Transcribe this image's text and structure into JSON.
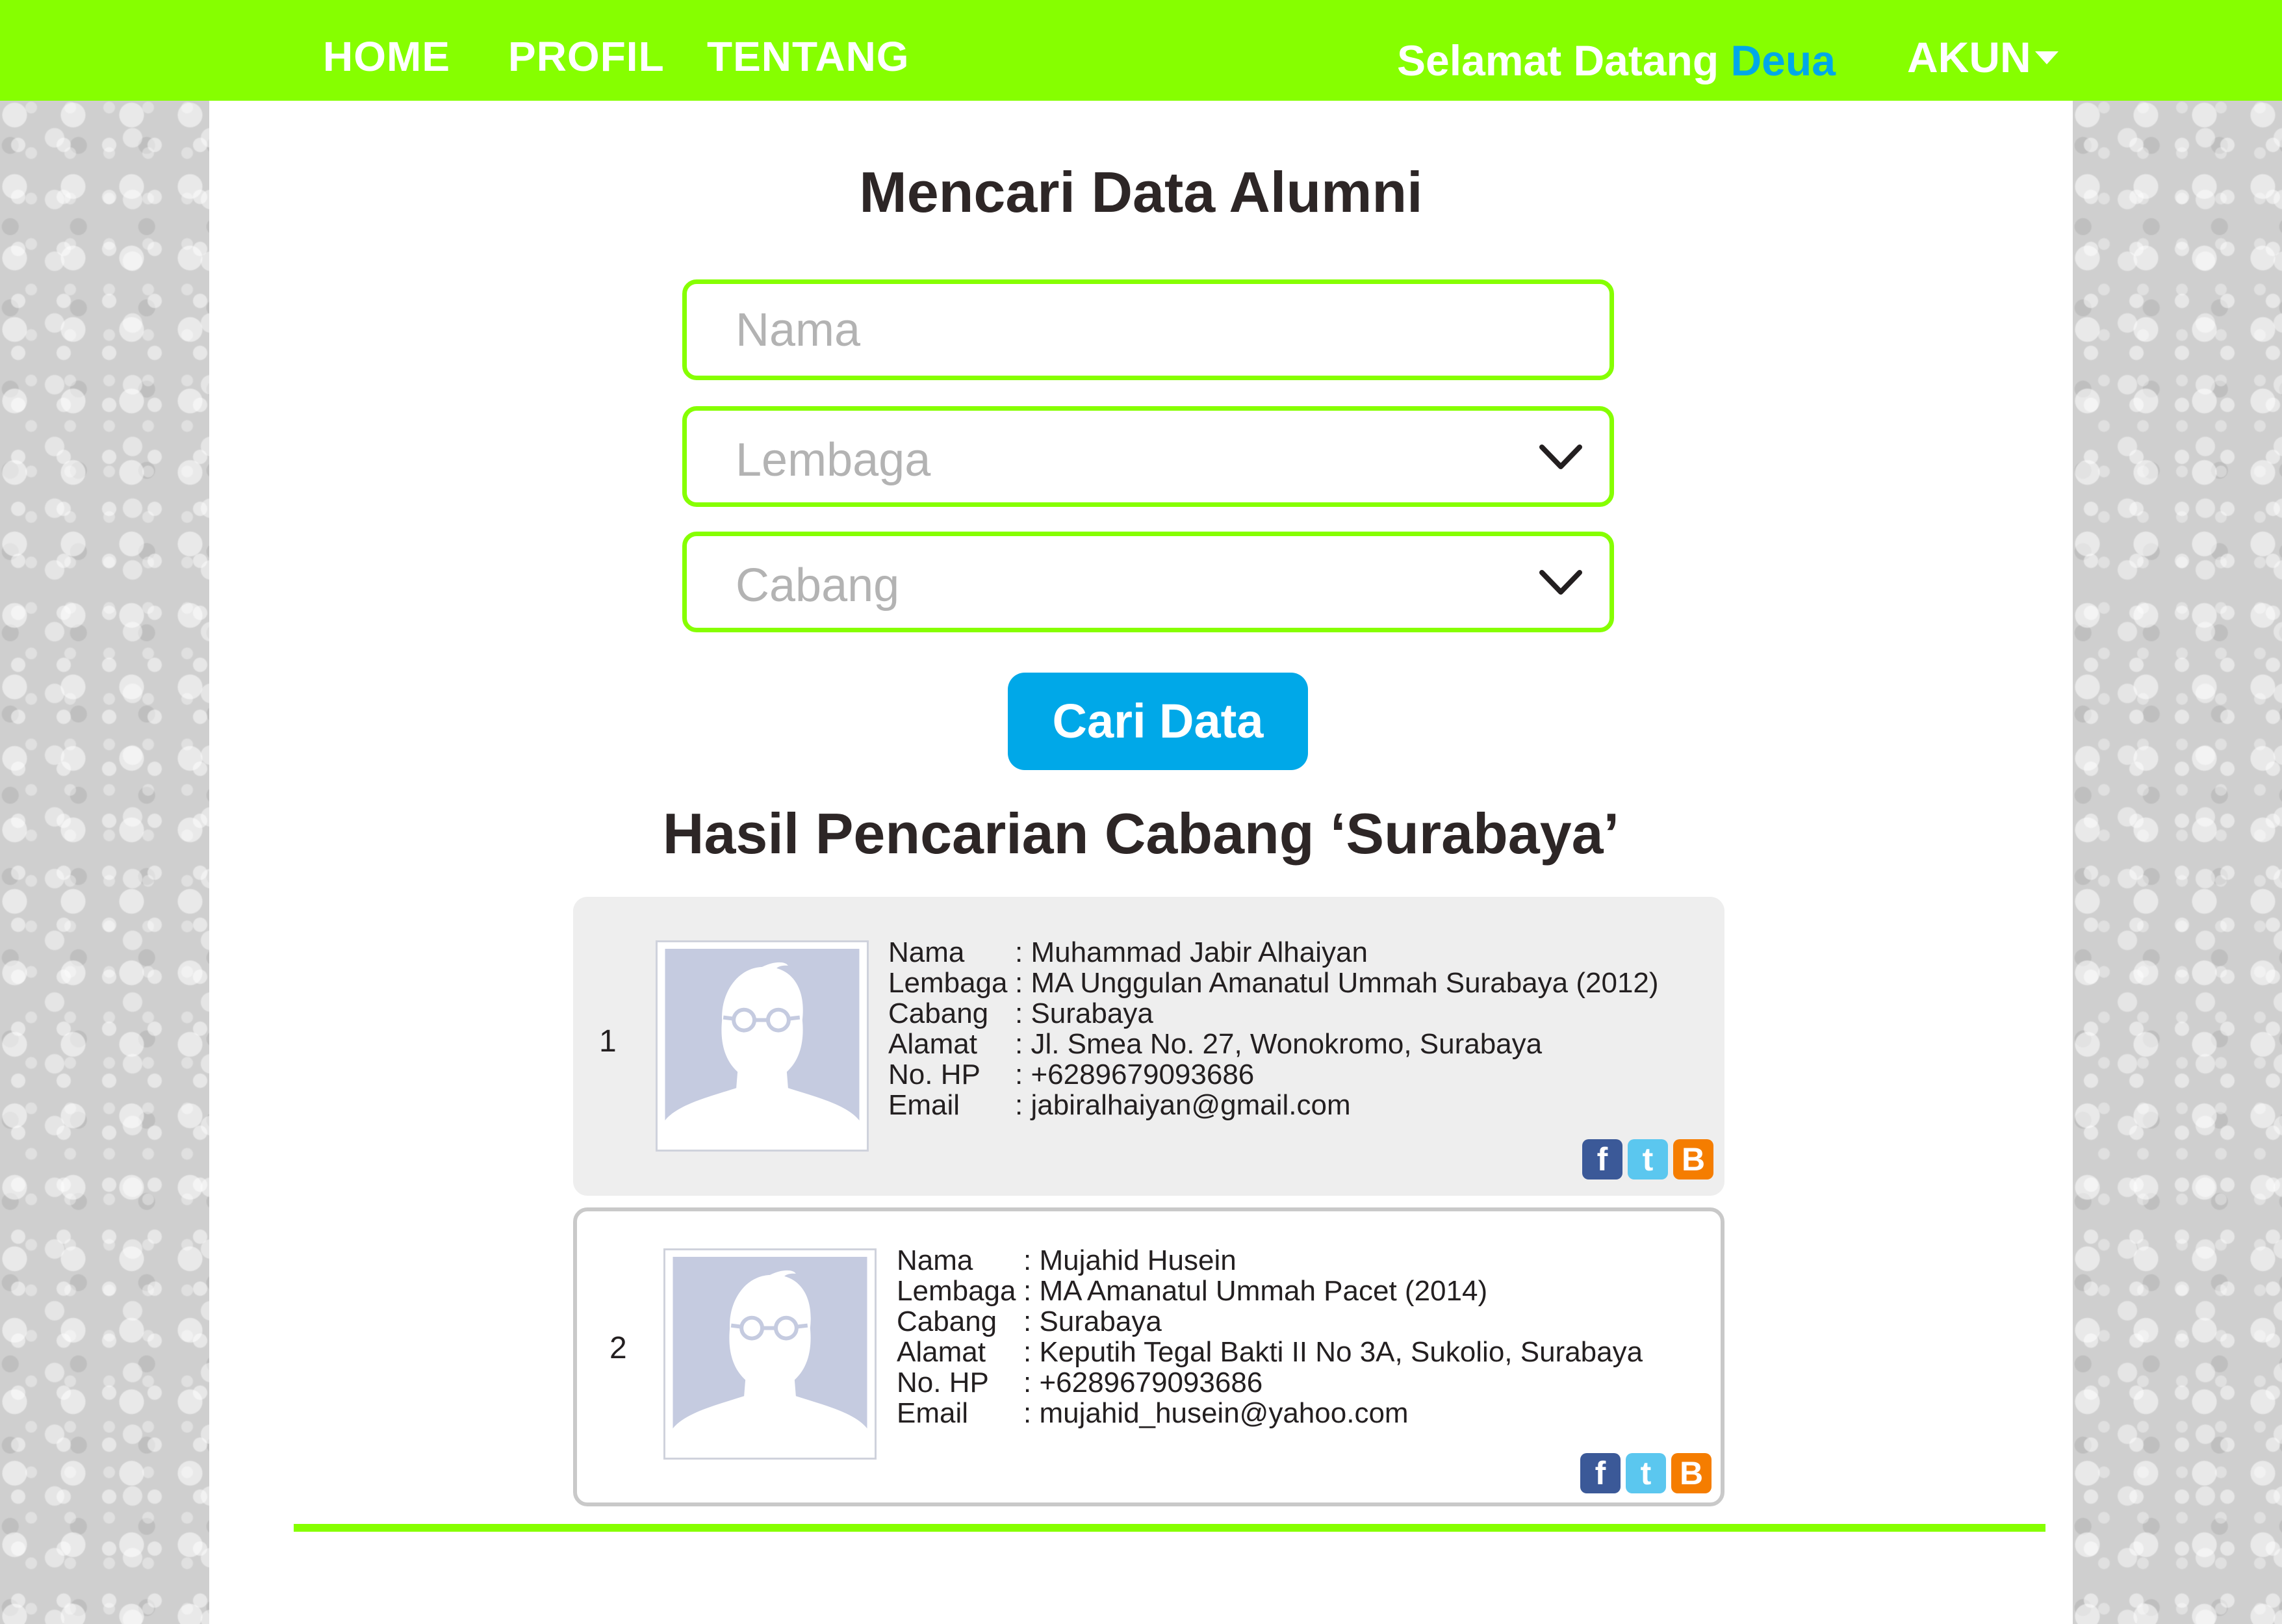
{
  "nav": {
    "home": "HOME",
    "profil": "PROFIL",
    "tentang": "TENTANG",
    "welcome_prefix": "Selamat Datang",
    "username": "Deua",
    "account": "AKUN"
  },
  "search": {
    "title": "Mencari Data Alumni",
    "name_placeholder": "Nama",
    "lembaga_label": "Lembaga",
    "cabang_label": "Cabang",
    "button": "Cari Data"
  },
  "results": {
    "title": "Hasil Pencarian Cabang ‘Surabaya’",
    "labels": {
      "nama": "Nama",
      "lembaga": "Lembaga",
      "cabang": "Cabang",
      "alamat": "Alamat",
      "hp": "No. HP",
      "email": "Email"
    },
    "items": [
      {
        "number": "1",
        "nama": ": Muhammad Jabir Alhaiyan",
        "lembaga": ": MA Unggulan Amanatul Ummah Surabaya (2012)",
        "cabang": ": Surabaya",
        "alamat": ": Jl. Smea No. 27, Wonokromo, Surabaya",
        "hp": ": +6289679093686",
        "email": ": jabiralhaiyan@gmail.com"
      },
      {
        "number": "2",
        "nama": ": Mujahid Husein",
        "lembaga": ": MA Amanatul Ummah Pacet (2014)",
        "cabang": ": Surabaya",
        "alamat": ": Keputih Tegal Bakti II No 3A, Sukolio, Surabaya",
        "hp": ": +6289679093686",
        "email": ": mujahid_husein@yahoo.com"
      }
    ]
  },
  "icons": {
    "facebook": "f",
    "twitter": "t",
    "blogger": "B"
  },
  "colors": {
    "accent_green": "#86ff00",
    "accent_blue": "#00a8e8",
    "text_dark": "#2d2626"
  }
}
